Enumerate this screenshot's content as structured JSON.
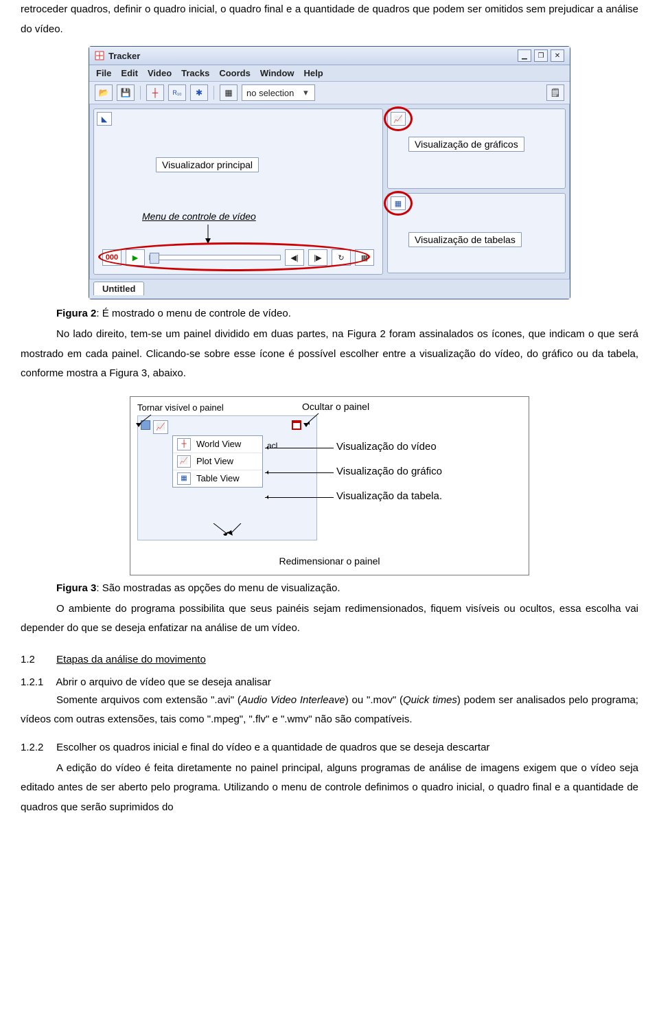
{
  "intro_para": "retroceder quadros, definir o quadro inicial, o quadro final e a quantidade de quadros que podem ser omitidos sem prejudicar a análise do vídeo.",
  "fig2_caption_bold": "Figura 2",
  "fig2_caption_rest": ": É mostrado o menu de controle de vídeo.",
  "para_after_fig2": "No lado direito, tem-se um painel dividido em duas partes, na Figura 2 foram assinalados os ícones, que indicam o que será mostrado em cada painel. Clicando-se sobre esse ícone é possível escolher entre a visualização do vídeo, do gráfico ou da tabela, conforme mostra a Figura 3, abaixo.",
  "fig3_caption_bold": "Figura 3",
  "fig3_caption_rest": ": São mostradas as opções do menu de visualização.",
  "para_after_fig3": "O ambiente do programa possibilita que seus painéis sejam redimensionados, fiquem visíveis ou ocultos, essa escolha vai depender do que se deseja enfatizar na análise de um vídeo.",
  "sec12_num": "1.2",
  "sec12_title": "Etapas da análise do movimento",
  "sec121_num": "1.2.1",
  "sec121_title": "Abrir o arquivo de vídeo que se deseja analisar",
  "sec121_body_a": "Somente arquivos com extensão \".avi\" (",
  "sec121_body_b": "Audio Video Interleave",
  "sec121_body_c": ") ou \".mov\" (",
  "sec121_body_d": "Quick times",
  "sec121_body_e": ") podem ser analisados pelo programa; vídeos com outras extensões, tais como \".mpeg\", \".flv\" e \".wmv\" não são compatíveis.",
  "sec122_num": "1.2.2",
  "sec122_title": "Escolher os quadros inicial e final do vídeo e a quantidade de quadros que se deseja descartar",
  "sec122_body": "A edição do vídeo é feita diretamente no painel principal, alguns programas de análise de imagens exigem que o vídeo seja editado antes de ser aberto pelo programa. Utilizando o menu de controle definimos o quadro inicial, o quadro final e a quantidade de quadros que serão suprimidos do",
  "tracker": {
    "title": "Tracker",
    "menu": [
      "File",
      "Edit",
      "Video",
      "Tracks",
      "Coords",
      "Window",
      "Help"
    ],
    "combo": "no selection",
    "main_label": "Visualizador principal",
    "ctrl_label": "Menu de controle de vídeo",
    "graph_label": "Visualização de gráficos",
    "table_label": "Visualização de tabelas",
    "tab": "Untitled",
    "frame": "000"
  },
  "fig3": {
    "top_left": "Tornar visível o painel",
    "top_right": "Ocultar o painel",
    "menu": {
      "world": "World View",
      "plot": "Plot View",
      "table": "Table View"
    },
    "right": {
      "video": "Visualização do vídeo",
      "graph": "Visualização do gráfico",
      "table": "Visualização da tabela."
    },
    "bottom": "Redimensionar o painel",
    "acl": "acl"
  }
}
